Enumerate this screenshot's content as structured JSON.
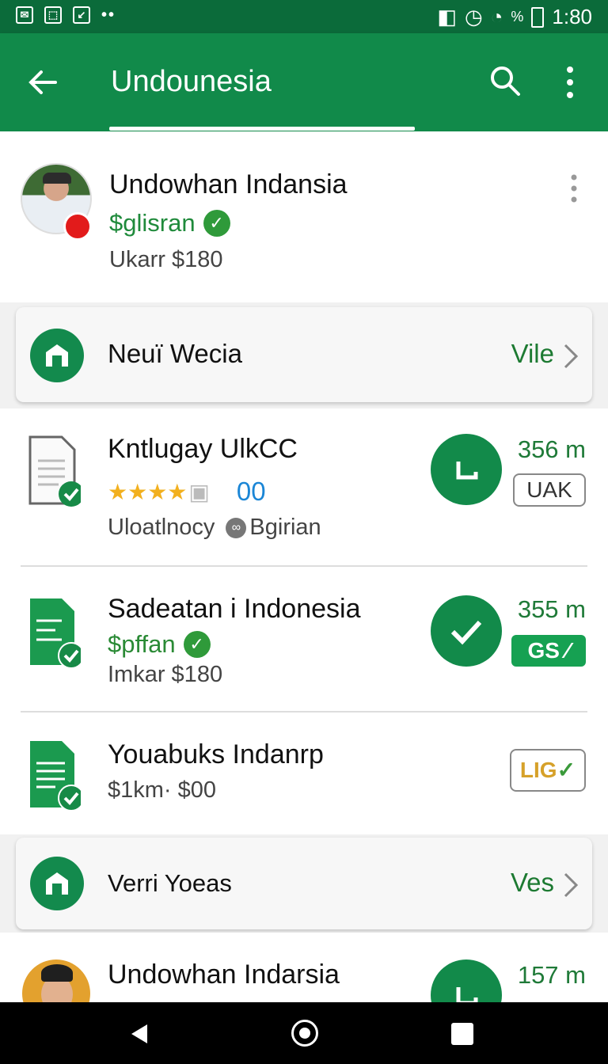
{
  "status_bar": {
    "time": "1:80",
    "battery_pct": "%"
  },
  "app_bar": {
    "title": "Undounesia"
  },
  "profile": {
    "name": "Undowhan Indansia",
    "status": "$glisran",
    "price": "Ukarr $180"
  },
  "sections": [
    {
      "label": "Neuï Wecia",
      "link": "Vile"
    },
    {
      "label": "Verri Yoeas",
      "link": "Ves"
    }
  ],
  "items": [
    {
      "title": "Kntlugay UlkCC",
      "rating_value": "00",
      "meta1": "Uloatlnocy",
      "meta2": "Bgirian",
      "distance": "356 m",
      "badge": "UAK"
    },
    {
      "title": "Sadeatan i Indonesia",
      "status": "$pffan",
      "price": "Imkar $180",
      "distance": "355 m",
      "badge": "GS ⁄"
    },
    {
      "title": "Youabuks Indanrp",
      "price": "$1km· $00",
      "badge_lig": "LIG"
    }
  ],
  "bottom_item": {
    "title": "Undowhan Indarsia",
    "distance": "157 m"
  },
  "colors": {
    "primary": "#118a4a",
    "dark": "#0b6b3a",
    "accent_green": "#1f8a3b",
    "blue": "#1b86d6"
  }
}
